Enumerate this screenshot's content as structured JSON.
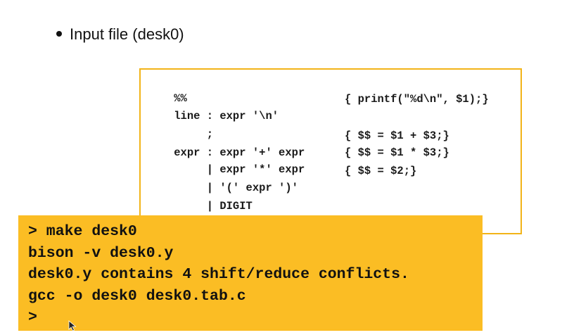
{
  "slide": {
    "bullet_text": "Input file (desk0)"
  },
  "code_box": {
    "lines": [
      {
        "rule": "%%",
        "action": ""
      },
      {
        "rule": "line : expr '\\n'",
        "action": "{ printf(\"%d\\n\", $1);}"
      },
      {
        "rule": "     ;",
        "action": ""
      },
      {
        "rule": "expr : expr '+' expr",
        "action": "{ $$ = $1 + $3;}"
      },
      {
        "rule": "     | expr '*' expr",
        "action": "{ $$ = $1 * $3;}"
      },
      {
        "rule": "     | '(' expr ')'",
        "action": "{ $$ = $2;}"
      },
      {
        "rule": "     | DIGIT",
        "action": ""
      },
      {
        "rule": "     ;",
        "action": ""
      }
    ]
  },
  "terminal": {
    "lines": [
      "> make desk0",
      "bison -v desk0.y",
      "desk0.y contains 4 shift/reduce conflicts.",
      "gcc -o desk0 desk0.tab.c",
      ">"
    ]
  },
  "colors": {
    "code_box_border": "#f2b418",
    "terminal_background": "#fbbd24",
    "text": "#111111"
  },
  "icons": {
    "pointer": "mouse-pointer-icon"
  }
}
